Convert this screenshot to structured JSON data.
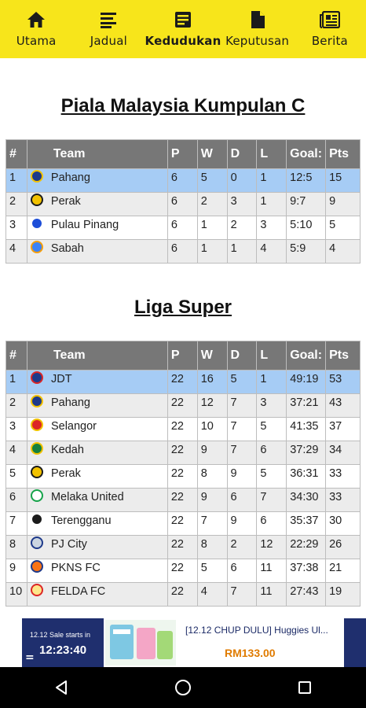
{
  "nav": [
    {
      "label": "Utama",
      "icon": "home-icon",
      "active": false
    },
    {
      "label": "Jadual",
      "icon": "list-icon",
      "active": false
    },
    {
      "label": "Kedudukan",
      "icon": "standings-icon",
      "active": true
    },
    {
      "label": "Keputusan",
      "icon": "document-icon",
      "active": false
    },
    {
      "label": "Berita",
      "icon": "newspaper-icon",
      "active": false
    }
  ],
  "headers": {
    "pos": "#",
    "team": "Team",
    "p": "P",
    "w": "W",
    "d": "D",
    "l": "L",
    "goals": "Goal:",
    "pts": "Pts"
  },
  "piala": {
    "title": "Piala Malaysia Kumpulan C",
    "rows": [
      {
        "pos": "1",
        "team": "Pahang",
        "p": "6",
        "w": "5",
        "d": "0",
        "l": "1",
        "goals": "12:5",
        "pts": "15"
      },
      {
        "pos": "2",
        "team": "Perak",
        "p": "6",
        "w": "2",
        "d": "3",
        "l": "1",
        "goals": "9:7",
        "pts": "9"
      },
      {
        "pos": "3",
        "team": "Pulau Pinang",
        "p": "6",
        "w": "1",
        "d": "2",
        "l": "3",
        "goals": "5:10",
        "pts": "5"
      },
      {
        "pos": "4",
        "team": "Sabah",
        "p": "6",
        "w": "1",
        "d": "1",
        "l": "4",
        "goals": "5:9",
        "pts": "4"
      }
    ]
  },
  "liga": {
    "title": "Liga Super",
    "rows": [
      {
        "pos": "1",
        "team": "JDT",
        "p": "22",
        "w": "16",
        "d": "5",
        "l": "1",
        "goals": "49:19",
        "pts": "53"
      },
      {
        "pos": "2",
        "team": "Pahang",
        "p": "22",
        "w": "12",
        "d": "7",
        "l": "3",
        "goals": "37:21",
        "pts": "43"
      },
      {
        "pos": "3",
        "team": "Selangor",
        "p": "22",
        "w": "10",
        "d": "7",
        "l": "5",
        "goals": "41:35",
        "pts": "37"
      },
      {
        "pos": "4",
        "team": "Kedah",
        "p": "22",
        "w": "9",
        "d": "7",
        "l": "6",
        "goals": "37:29",
        "pts": "34"
      },
      {
        "pos": "5",
        "team": "Perak",
        "p": "22",
        "w": "8",
        "d": "9",
        "l": "5",
        "goals": "36:31",
        "pts": "33"
      },
      {
        "pos": "6",
        "team": "Melaka United",
        "p": "22",
        "w": "9",
        "d": "6",
        "l": "7",
        "goals": "34:30",
        "pts": "33"
      },
      {
        "pos": "7",
        "team": "Terengganu",
        "p": "22",
        "w": "7",
        "d": "9",
        "l": "6",
        "goals": "35:37",
        "pts": "30"
      },
      {
        "pos": "8",
        "team": "PJ City",
        "p": "22",
        "w": "8",
        "d": "2",
        "l": "12",
        "goals": "22:29",
        "pts": "26"
      },
      {
        "pos": "9",
        "team": "PKNS FC",
        "p": "22",
        "w": "5",
        "d": "6",
        "l": "11",
        "goals": "37:38",
        "pts": "21"
      },
      {
        "pos": "10",
        "team": "FELDA FC",
        "p": "22",
        "w": "4",
        "d": "7",
        "l": "11",
        "goals": "27:43",
        "pts": "19"
      }
    ]
  },
  "ad": {
    "sale_text": "12.12 Sale starts in",
    "timer": "12:23:40",
    "title": "[12.12 CHUP DULU] Huggies Ul...",
    "price": "RM133.00"
  },
  "colors": {
    "accent": "#f7e51b",
    "header": "#777777",
    "highlight": "#a6ccf5",
    "stripe": "#ececec"
  }
}
